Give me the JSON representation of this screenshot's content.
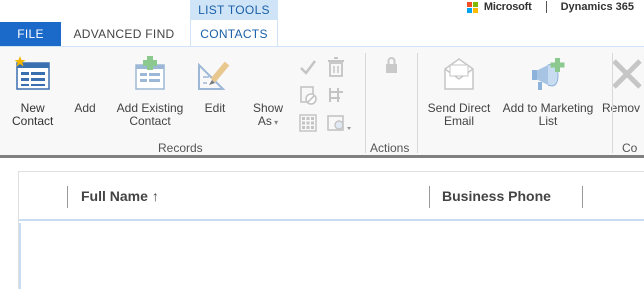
{
  "tabs": {
    "file": "FILE",
    "advanced_find": "ADVANCED FIND",
    "contextual_group": "LIST TOOLS",
    "contacts": "CONTACTS"
  },
  "brand": {
    "company": "Microsoft",
    "product": "Dynamics 365",
    "logo_colors": [
      "#f25022",
      "#7fba00",
      "#00a4ef",
      "#ffb900"
    ]
  },
  "ribbon": {
    "buttons": [
      {
        "id": "new-contact",
        "label": "New\nContact",
        "icon": "new-contact-icon"
      },
      {
        "id": "add",
        "label": "Add",
        "icon": ""
      },
      {
        "id": "add-existing-contact",
        "label": "Add Existing\nContact",
        "icon": "add-existing-icon"
      },
      {
        "id": "edit",
        "label": "Edit",
        "icon": "edit-icon"
      },
      {
        "id": "show-as",
        "label": "Show\nAs",
        "icon": ""
      },
      {
        "id": "send-direct-email",
        "label": "Send Direct\nEmail",
        "icon": "email-icon"
      },
      {
        "id": "add-to-marketing-list",
        "label": "Add to Marketing\nList",
        "icon": "marketing-list-icon"
      },
      {
        "id": "remove",
        "label": "Remov",
        "icon": "remove-icon"
      }
    ],
    "groups": {
      "records": "Records",
      "actions": "Actions",
      "collaborate_partial": "Co"
    }
  },
  "grid": {
    "columns": [
      {
        "label": "Full Name",
        "sort": "↑"
      },
      {
        "label": "Business Phone"
      }
    ]
  },
  "colors": {
    "accent": "#1b6ac9",
    "contextual_tab": "#cfe5f7",
    "header_underline": "#c7ddf3"
  }
}
